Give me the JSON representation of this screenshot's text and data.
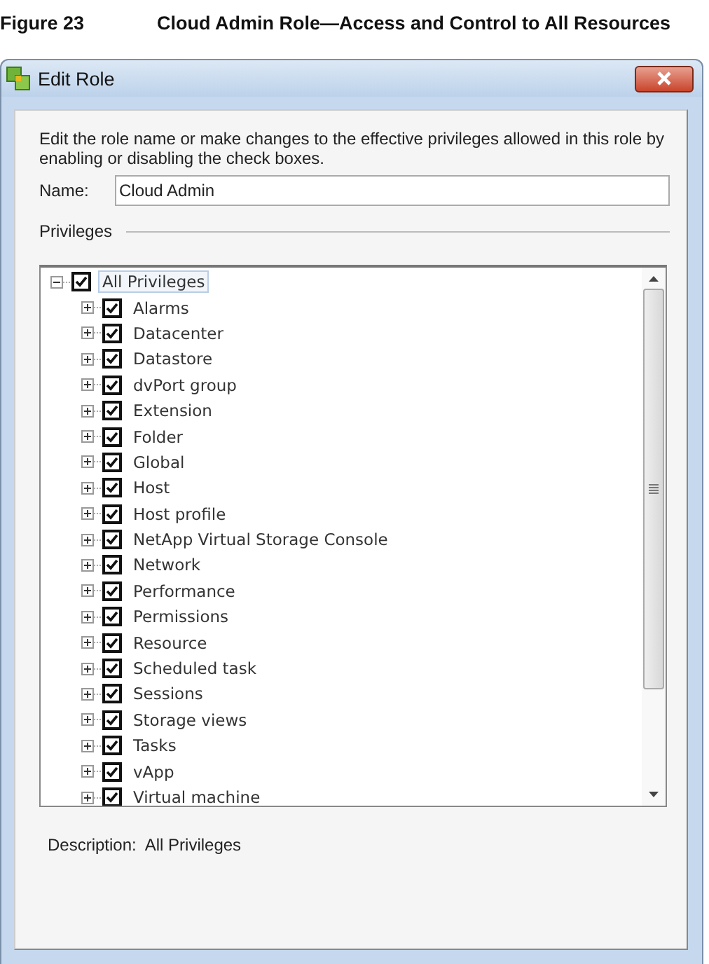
{
  "caption": {
    "label": "Figure 23",
    "title": "Cloud Admin Role—Access and Control to All Resources"
  },
  "window": {
    "title": "Edit Role"
  },
  "instructions": "Edit the role name or make changes to the effective privileges allowed in this role by enabling or disabling the check boxes.",
  "name_field": {
    "label": "Name:",
    "value": "Cloud Admin"
  },
  "privileges_group": {
    "label": "Privileges"
  },
  "tree": [
    {
      "label": "All Privileges",
      "checked": true,
      "expanded": true,
      "selected": true,
      "children": [
        {
          "label": "Alarms",
          "checked": true,
          "expanded": false,
          "selected": false
        },
        {
          "label": "Datacenter",
          "checked": true,
          "expanded": false,
          "selected": false
        },
        {
          "label": "Datastore",
          "checked": true,
          "expanded": false,
          "selected": false
        },
        {
          "label": "dvPort group",
          "checked": true,
          "expanded": false,
          "selected": false
        },
        {
          "label": "Extension",
          "checked": true,
          "expanded": false,
          "selected": false
        },
        {
          "label": "Folder",
          "checked": true,
          "expanded": false,
          "selected": false
        },
        {
          "label": "Global",
          "checked": true,
          "expanded": false,
          "selected": false
        },
        {
          "label": "Host",
          "checked": true,
          "expanded": false,
          "selected": false
        },
        {
          "label": "Host profile",
          "checked": true,
          "expanded": false,
          "selected": false
        },
        {
          "label": "NetApp Virtual Storage Console",
          "checked": true,
          "expanded": false,
          "selected": false
        },
        {
          "label": "Network",
          "checked": true,
          "expanded": false,
          "selected": false
        },
        {
          "label": "Performance",
          "checked": true,
          "expanded": false,
          "selected": false
        },
        {
          "label": "Permissions",
          "checked": true,
          "expanded": false,
          "selected": false
        },
        {
          "label": "Resource",
          "checked": true,
          "expanded": false,
          "selected": false
        },
        {
          "label": "Scheduled task",
          "checked": true,
          "expanded": false,
          "selected": false
        },
        {
          "label": "Sessions",
          "checked": true,
          "expanded": false,
          "selected": false
        },
        {
          "label": "Storage views",
          "checked": true,
          "expanded": false,
          "selected": false
        },
        {
          "label": "Tasks",
          "checked": true,
          "expanded": false,
          "selected": false
        },
        {
          "label": "vApp",
          "checked": true,
          "expanded": false,
          "selected": false
        },
        {
          "label": "Virtual machine",
          "checked": true,
          "expanded": false,
          "selected": false
        }
      ]
    }
  ],
  "description": {
    "label": "Description:",
    "value": "All Privileges"
  }
}
